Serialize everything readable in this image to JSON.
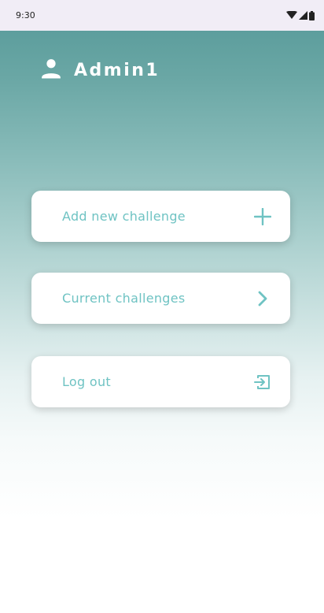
{
  "status_bar": {
    "time": "9:30",
    "icons": [
      "wifi-icon",
      "signal-icon",
      "battery-icon"
    ]
  },
  "header": {
    "icon": "person-icon",
    "username": "Admin1"
  },
  "menu": {
    "items": [
      {
        "label": "Add new challenge",
        "icon": "plus-icon"
      },
      {
        "label": "Current challenges",
        "icon": "chevron-right-icon"
      },
      {
        "label": "Log out",
        "icon": "logout-icon"
      }
    ]
  },
  "colors": {
    "accent": "#6fc3c3",
    "header_teal": "#5d9e9d",
    "status_bar": "#f1edf6"
  }
}
